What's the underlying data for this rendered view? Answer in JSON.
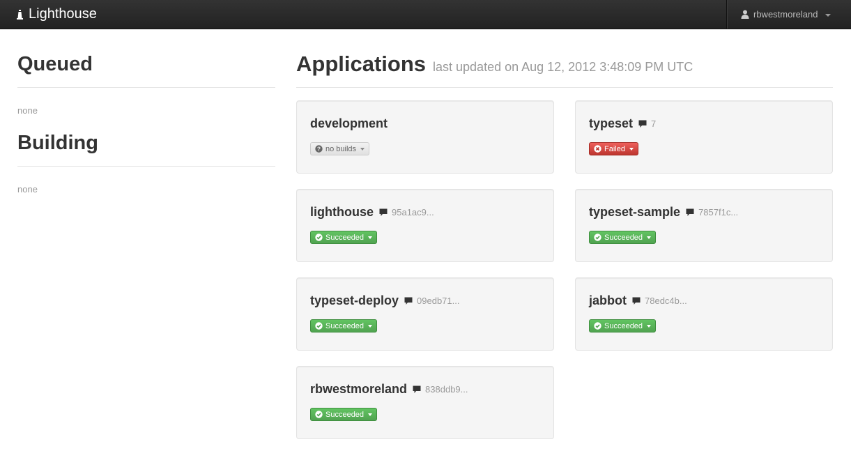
{
  "navbar": {
    "brand": "Lighthouse",
    "user": "rbwestmoreland"
  },
  "sidebar": {
    "queued": {
      "title": "Queued",
      "value": "none"
    },
    "building": {
      "title": "Building",
      "value": "none"
    }
  },
  "applications": {
    "title": "Applications",
    "subtitle": "last updated on Aug 12, 2012 3:48:09 PM UTC",
    "items": [
      {
        "name": "development",
        "sha": "",
        "status": "no builds",
        "kind": "default"
      },
      {
        "name": "typeset",
        "sha": "7",
        "status": "Failed",
        "kind": "danger"
      },
      {
        "name": "lighthouse",
        "sha": "95a1ac9...",
        "status": "Succeeded",
        "kind": "success"
      },
      {
        "name": "typeset-sample",
        "sha": "7857f1c...",
        "status": "Succeeded",
        "kind": "success"
      },
      {
        "name": "typeset-deploy",
        "sha": "09edb71...",
        "status": "Succeeded",
        "kind": "success"
      },
      {
        "name": "jabbot",
        "sha": "78edc4b...",
        "status": "Succeeded",
        "kind": "success"
      },
      {
        "name": "rbwestmoreland",
        "sha": "838ddb9...",
        "status": "Succeeded",
        "kind": "success"
      }
    ]
  },
  "icons": {
    "brand": "lighthouse-icon",
    "user": "user-icon",
    "comment": "comment-icon",
    "success": "check-circle-icon",
    "danger": "x-circle-icon",
    "default": "question-circle-icon"
  },
  "colors": {
    "success": "#51a351",
    "danger": "#bd362f",
    "navbar": "#222222",
    "card": "#f5f5f5"
  }
}
